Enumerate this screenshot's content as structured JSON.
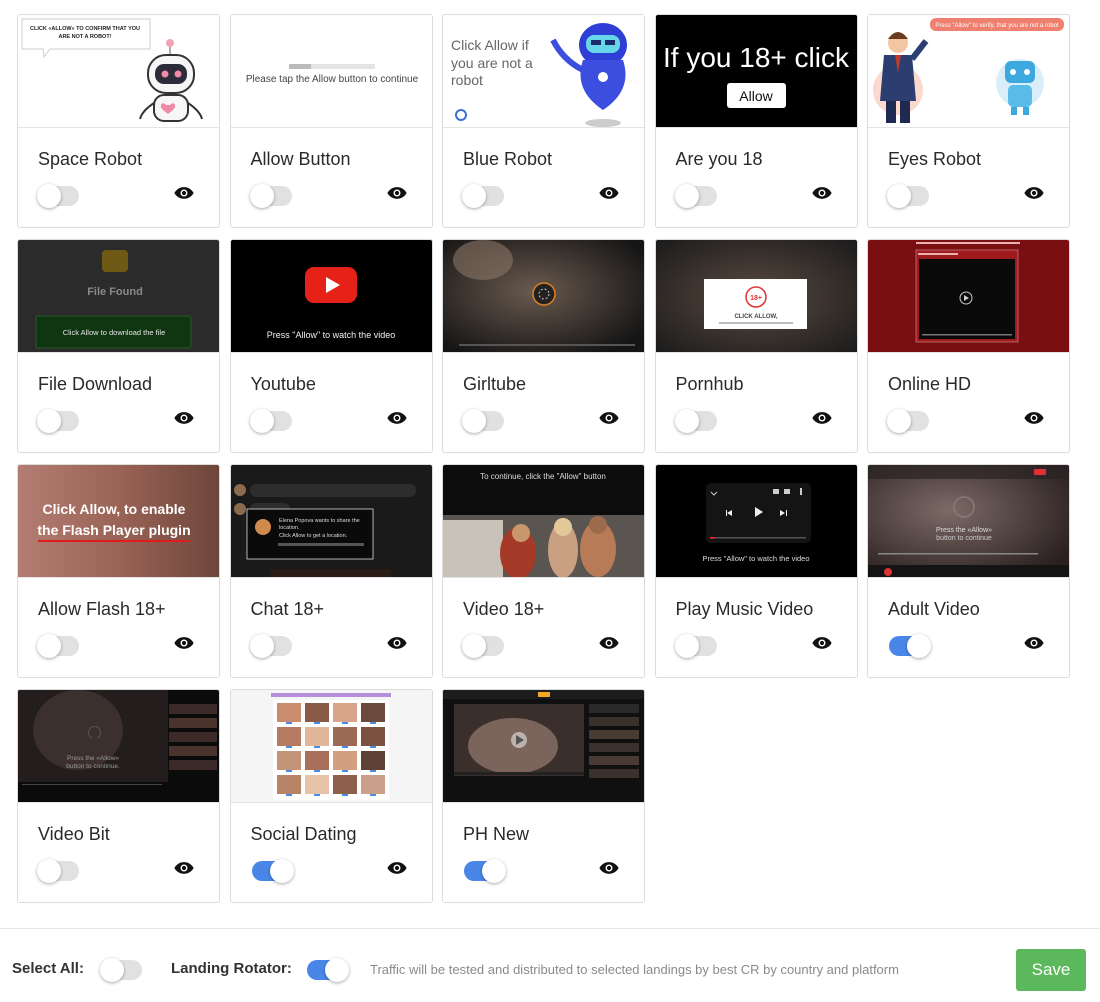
{
  "landings": [
    {
      "title": "Space Robot",
      "enabled": false,
      "thumb_text": [
        "CLICK «ALLOW» TO CONFIRM THAT YOU",
        "ARE NOT A ROBOT!"
      ]
    },
    {
      "title": "Allow Button",
      "enabled": false,
      "thumb_text": [
        "Please tap the Allow button to continue"
      ]
    },
    {
      "title": "Blue Robot",
      "enabled": false,
      "thumb_text": [
        "Click Allow if",
        "you are not a",
        "robot"
      ]
    },
    {
      "title": "Are you 18",
      "enabled": false,
      "thumb_text": [
        "If you 18+ click",
        "Allow"
      ]
    },
    {
      "title": "Eyes Robot",
      "enabled": false,
      "thumb_text": [
        "Press \"Allow\" to verify, that you are not a robot"
      ]
    },
    {
      "title": "File Download",
      "enabled": false,
      "thumb_text": [
        "File Found",
        "Click Allow to download the file"
      ]
    },
    {
      "title": "Youtube",
      "enabled": false,
      "thumb_text": [
        "Press \"Allow\" to watch the video"
      ]
    },
    {
      "title": "Girltube",
      "enabled": false,
      "thumb_text": []
    },
    {
      "title": "Pornhub",
      "enabled": false,
      "thumb_text": [
        "18+",
        "CLICK ALLOW,"
      ]
    },
    {
      "title": "Online HD",
      "enabled": false,
      "thumb_text": []
    },
    {
      "title": "Allow Flash 18+",
      "enabled": false,
      "thumb_text": [
        "Click Allow, to enable",
        "the Flash Player plugin"
      ]
    },
    {
      "title": "Chat 18+",
      "enabled": false,
      "thumb_text": [
        "Elena Popova wants to share the",
        "location.",
        "Click Allow to get a location."
      ]
    },
    {
      "title": "Video 18+",
      "enabled": false,
      "thumb_text": [
        "To continue, click the \"Allow\" button"
      ]
    },
    {
      "title": "Play Music Video",
      "enabled": false,
      "thumb_text": [
        "Press \"Allow\" to watch the video"
      ]
    },
    {
      "title": "Adult Video",
      "enabled": true,
      "thumb_text": [
        "Press the «Allow»",
        "button to continue"
      ]
    },
    {
      "title": "Video Bit",
      "enabled": false,
      "thumb_text": [
        "Press the «Allow»",
        "button to continue."
      ]
    },
    {
      "title": "Social Dating",
      "enabled": true,
      "thumb_text": []
    },
    {
      "title": "PH New",
      "enabled": true,
      "thumb_text": []
    }
  ],
  "footer": {
    "select_all_label": "Select All:",
    "select_all_enabled": false,
    "rotator_label": "Landing Rotator:",
    "rotator_enabled": true,
    "rotator_note": "Traffic will be tested and distributed to selected landings by best CR by country and platform",
    "save_label": "Save"
  },
  "colors": {
    "toggle_on": "#4a86e8",
    "toggle_off": "#e1e1e1",
    "save_button": "#5cb85c"
  },
  "icons": {
    "preview": "eye-icon"
  }
}
